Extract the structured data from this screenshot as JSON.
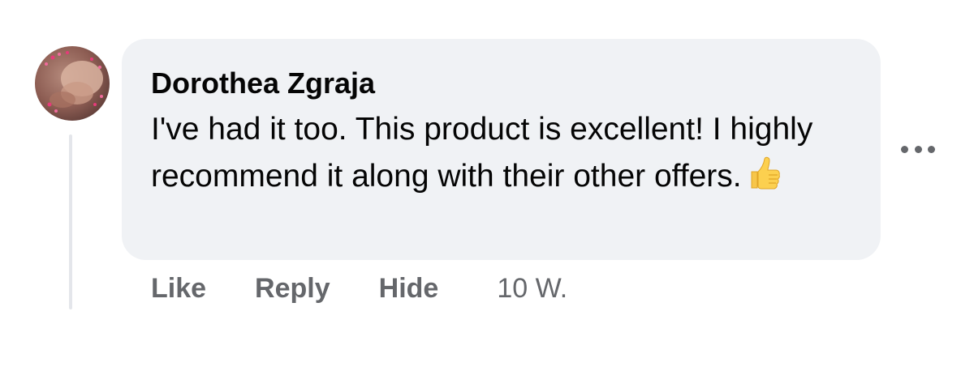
{
  "comment": {
    "author": "Dorothea Zgraja",
    "text": "I've had it too. This product is excellent! I highly recommend it along with their other offers.",
    "emoji": "thumbs-up-emoji",
    "timestamp": "10 W."
  },
  "actions": {
    "like_label": "Like",
    "reply_label": "Reply",
    "hide_label": "Hide"
  },
  "icons": {
    "more_options": "more-options-icon",
    "avatar": "avatar"
  },
  "colors": {
    "bubble_bg": "#f0f2f5",
    "text_primary": "#050505",
    "text_secondary": "#65676b",
    "thread_line": "#e4e6eb"
  }
}
